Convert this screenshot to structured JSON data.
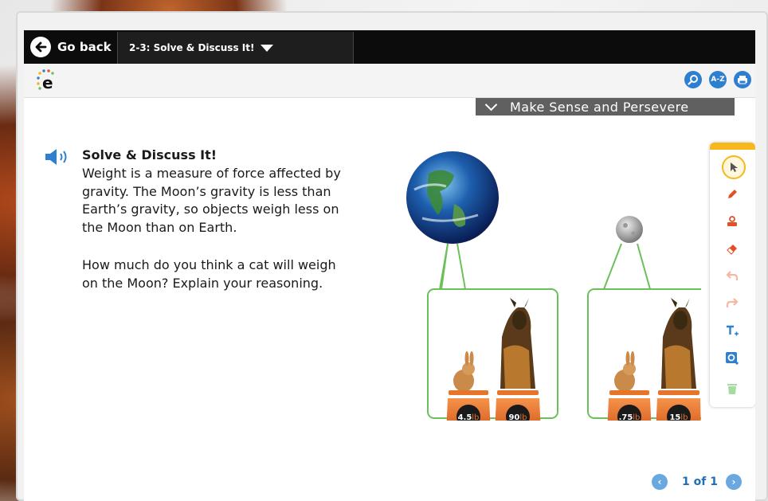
{
  "topbar": {
    "go_back_label": "Go back",
    "lesson_tab_label": "2-3: Solve & Discuss It!"
  },
  "header": {
    "logo_text": "e",
    "buttons": [
      "search",
      "A-Z",
      "print"
    ],
    "az_label": "A-Z"
  },
  "practice_bar": {
    "label": "Make Sense and Persevere"
  },
  "content": {
    "heading": "Solve & Discuss It!",
    "paragraph_lines": [
      "Weight is a measure of force affected by",
      "gravity. The Moon’s gravity is less than",
      "Earth’s gravity, so objects weigh less on",
      "the Moon than on Earth."
    ],
    "question_lines": [
      "How much do you think a cat will weigh",
      "on the Moon? Explain your reasoning."
    ]
  },
  "illustration": {
    "earth_scales": {
      "rabbit": "4.5",
      "dog": "90",
      "unit": "lb"
    },
    "moon_scales": {
      "rabbit": ".75",
      "dog": "15",
      "unit": "lb"
    }
  },
  "toolbar": {
    "tools": [
      "select",
      "pencil",
      "stamp",
      "eraser",
      "undo",
      "redo",
      "text",
      "zoom",
      "trash"
    ]
  },
  "pager": {
    "label": "1 of 1"
  },
  "colors": {
    "accent_blue": "#2d7fd0",
    "toolbar_yellow": "#f6b81c",
    "scale_orange": "#e8742a",
    "frame_green": "#6cc05a"
  }
}
